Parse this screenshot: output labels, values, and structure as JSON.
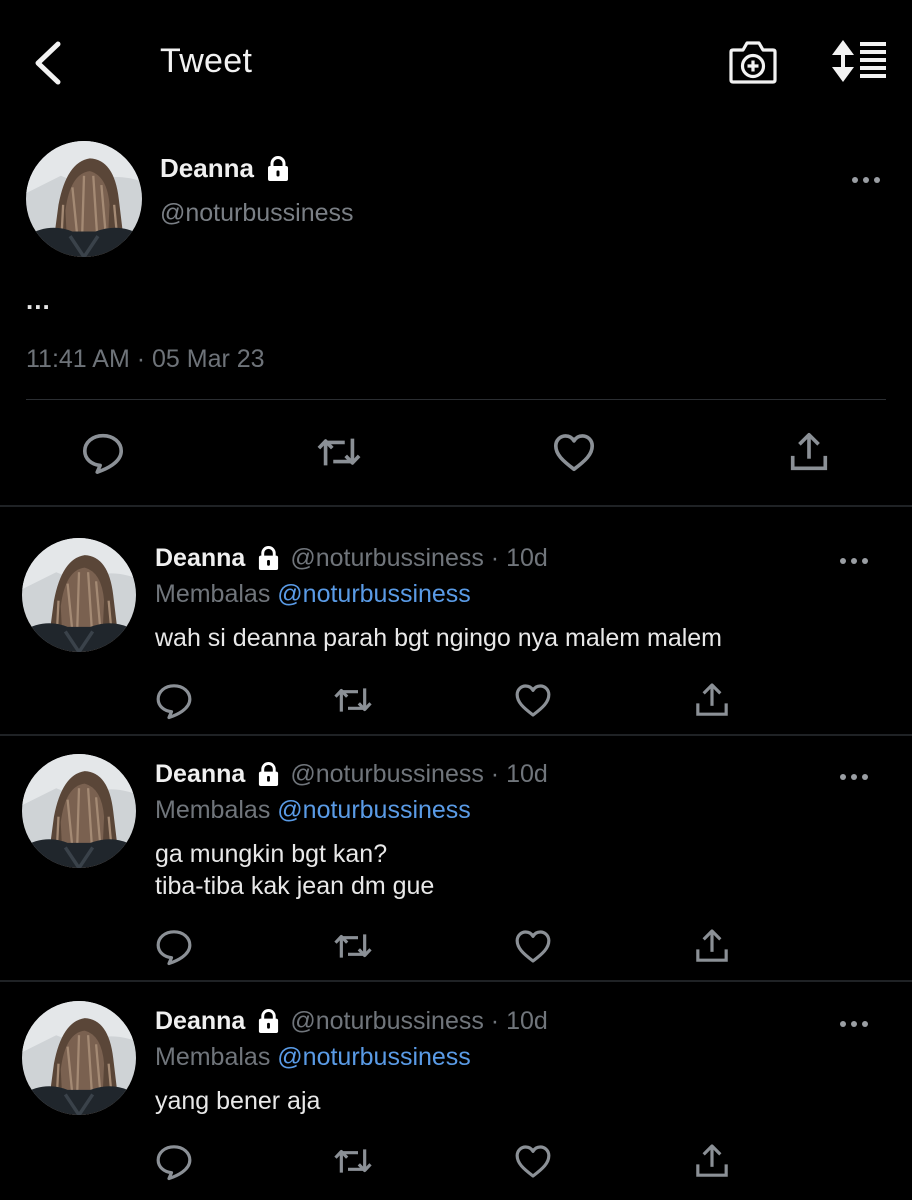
{
  "header": {
    "title": "Tweet",
    "back_icon": "chevron-left-icon",
    "camera_icon": "camera-plus-icon",
    "sort_icon": "sort-list-icon"
  },
  "main_tweet": {
    "name": "Deanna",
    "handle": "@noturbussiness",
    "text": "...",
    "timestamp": "11:41 AM · 05 Mar 23"
  },
  "replies": [
    {
      "name": "Deanna",
      "handle": "@noturbussiness",
      "age": "10d",
      "replying_label": "Membalas",
      "replying_to": "@noturbussiness",
      "lines": [
        "wah si deanna parah bgt ngingo nya malem malem"
      ]
    },
    {
      "name": "Deanna",
      "handle": "@noturbussiness",
      "age": "10d",
      "replying_label": "Membalas",
      "replying_to": "@noturbussiness",
      "lines": [
        "ga mungkin bgt kan?",
        "tiba-tiba kak jean dm gue"
      ]
    },
    {
      "name": "Deanna",
      "handle": "@noturbussiness",
      "age": "10d",
      "replying_label": "Membalas",
      "replying_to": "@noturbussiness",
      "lines": [
        "yang bener aja"
      ]
    }
  ],
  "colors": {
    "background": "#000000",
    "text": "#e8e8e8",
    "muted": "#70757b",
    "link": "#5a9be6",
    "divider": "#2b2e32"
  }
}
